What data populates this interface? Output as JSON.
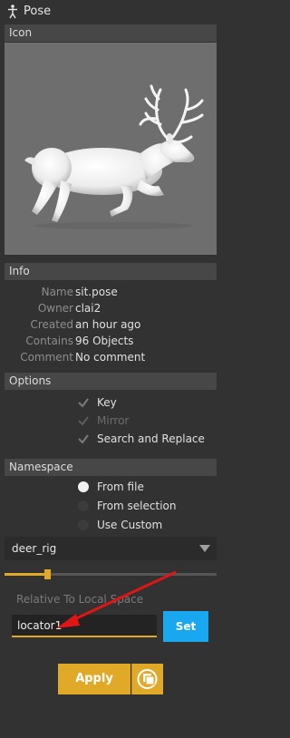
{
  "window": {
    "title": "Pose",
    "icon": "figure-icon"
  },
  "sections": {
    "icon": "Icon",
    "info": "Info",
    "options": "Options",
    "namespace": "Namespace"
  },
  "thumbnail": {
    "alt": "deer pose",
    "bg": "#6e6e6e"
  },
  "info": {
    "name_label": "Name",
    "name_value": "sit.pose",
    "owner_label": "Owner",
    "owner_value": "clai2",
    "created_label": "Created",
    "created_value": "an hour ago",
    "contains_label": "Contains",
    "contains_value": "96 Objects",
    "comment_label": "Comment",
    "comment_value": "No comment"
  },
  "options": {
    "key": {
      "label": "Key",
      "checked": true,
      "enabled": true
    },
    "mirror": {
      "label": "Mirror",
      "checked": true,
      "enabled": false
    },
    "search_replace": {
      "label": "Search and Replace",
      "checked": true,
      "enabled": true
    }
  },
  "namespace": {
    "from_file": {
      "label": "From file",
      "selected": true
    },
    "from_selection": {
      "label": "From selection",
      "selected": false
    },
    "use_custom": {
      "label": "Use Custom",
      "selected": false
    },
    "combo_value": "deer_rig"
  },
  "blend_slider": {
    "value": 0.2
  },
  "relative": {
    "label": "Relative To Local Space",
    "input_value": "locator1",
    "set_label": "Set"
  },
  "apply": {
    "label": "Apply",
    "mode_icon": "mode-icon"
  },
  "colors": {
    "accent": "#e1a928",
    "blue": "#19a7f0",
    "arrow": "#e01515"
  }
}
